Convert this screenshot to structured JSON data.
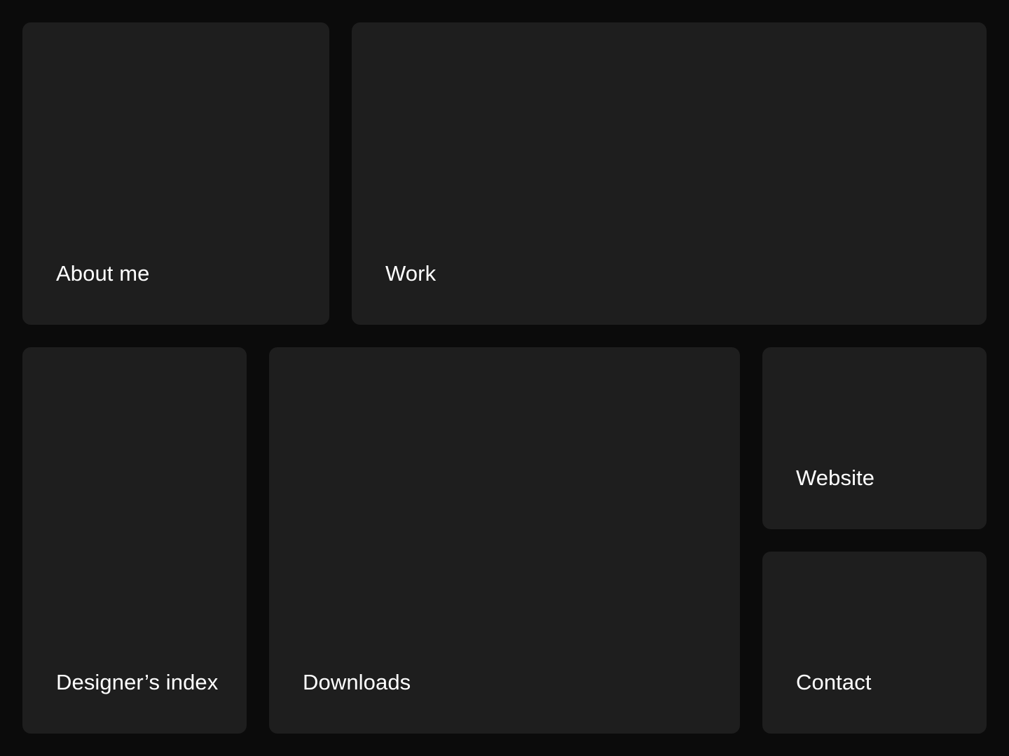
{
  "tiles": {
    "about": {
      "label": "About me"
    },
    "work": {
      "label": "Work"
    },
    "designers_index": {
      "label": "Designer’s index"
    },
    "downloads": {
      "label": "Downloads"
    },
    "website": {
      "label": "Website"
    },
    "contact": {
      "label": "Contact"
    }
  },
  "colors": {
    "background": "#0b0b0b",
    "tile": "#1e1e1e",
    "text": "#ffffff"
  }
}
